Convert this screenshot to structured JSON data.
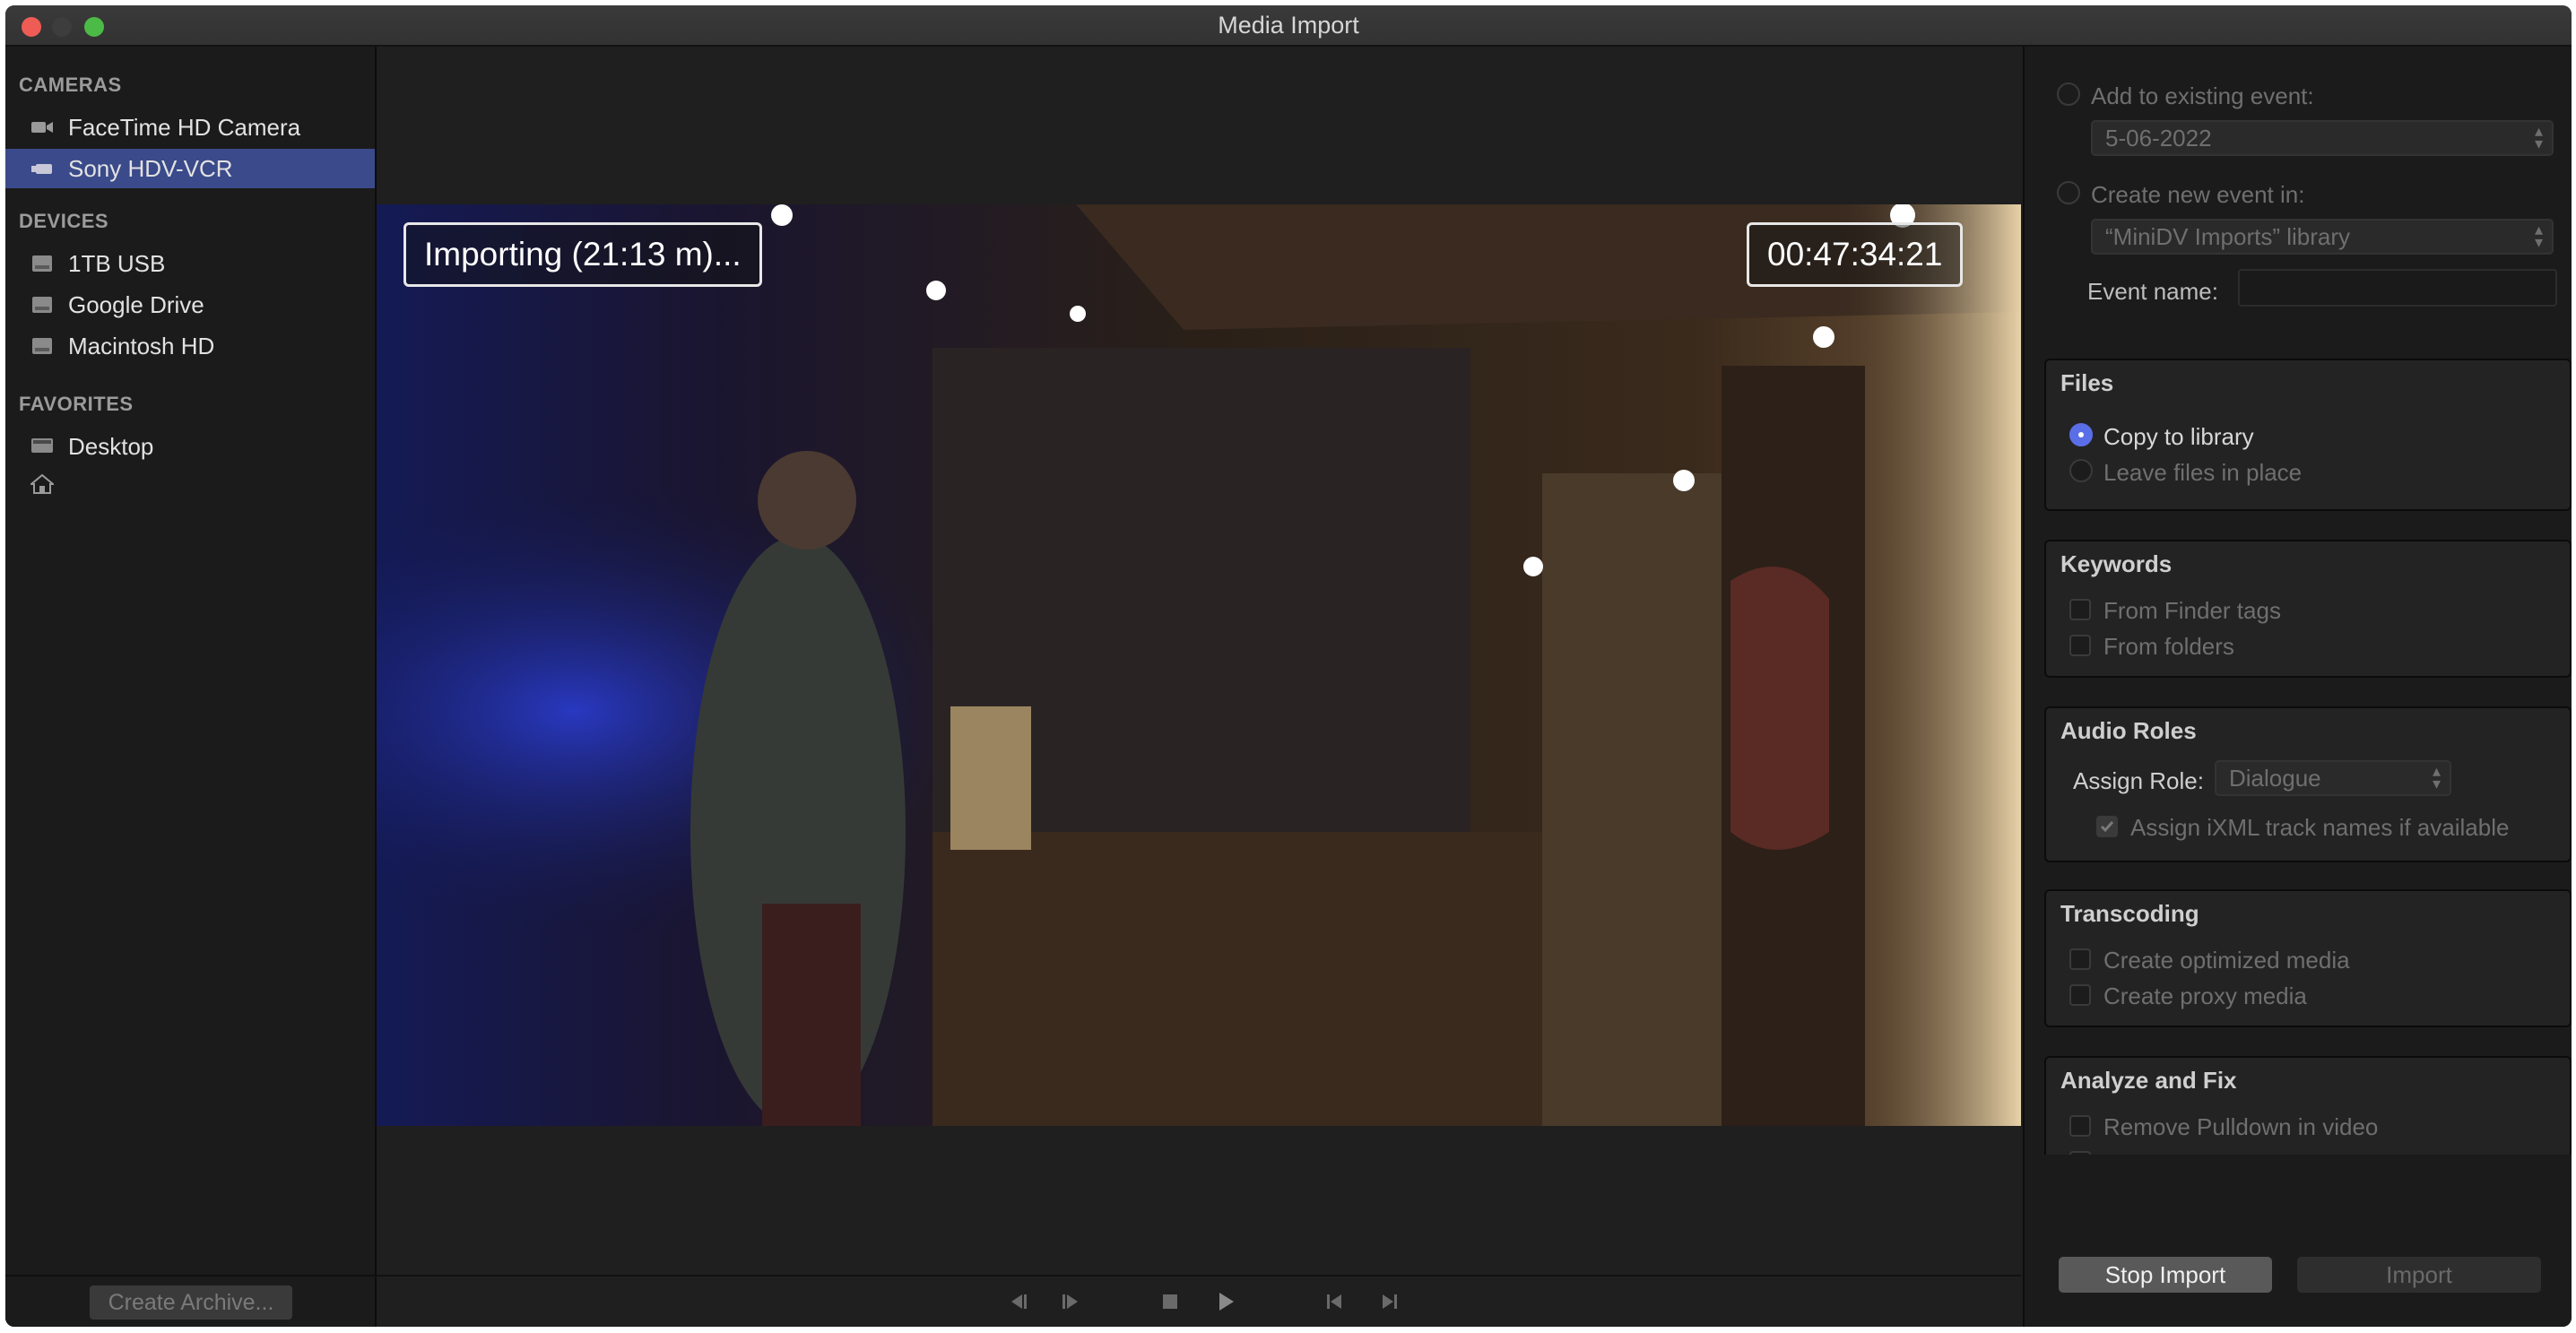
{
  "window": {
    "title": "Media Import"
  },
  "sidebar": {
    "cameras_header": "CAMERAS",
    "cameras": [
      {
        "label": "FaceTime HD Camera",
        "icon": "video-camera-icon"
      },
      {
        "label": "Sony HDV-VCR",
        "icon": "camcorder-icon",
        "selected": true
      }
    ],
    "devices_header": "DEVICES",
    "devices": [
      {
        "label": "1TB USB",
        "icon": "drive-icon"
      },
      {
        "label": "Google Drive",
        "icon": "drive-icon"
      },
      {
        "label": "Macintosh HD",
        "icon": "drive-icon"
      }
    ],
    "favorites_header": "FAVORITES",
    "favorites": [
      {
        "label": "Desktop",
        "icon": "desktop-icon"
      },
      {
        "label": "",
        "icon": "home-icon"
      }
    ],
    "archive_button": "Create Archive..."
  },
  "viewer": {
    "status": "Importing (21:13 m)...",
    "timecode": "00:47:34:21",
    "accent": "#5a6ee8"
  },
  "inspector": {
    "add_existing_label": "Add to existing event:",
    "existing_event_value": "5-06-2022",
    "create_new_label": "Create new event in:",
    "library_value": "“MiniDV Imports” library",
    "event_name_label": "Event name:",
    "event_name_value": "",
    "files": {
      "title": "Files",
      "copy_label": "Copy to library",
      "leave_label": "Leave files in place"
    },
    "keywords": {
      "title": "Keywords",
      "finder_tags": "From Finder tags",
      "folders": "From folders"
    },
    "audio_roles": {
      "title": "Audio Roles",
      "assign_label": "Assign Role:",
      "role_value": "Dialogue",
      "ixml_label": "Assign iXML track names if available"
    },
    "transcoding": {
      "title": "Transcoding",
      "optimized": "Create optimized media",
      "proxy": "Create proxy media"
    },
    "analyze": {
      "title": "Analyze and Fix",
      "pulldown": "Remove Pulldown in video"
    },
    "stop_button": "Stop Import",
    "import_button": "Import"
  }
}
